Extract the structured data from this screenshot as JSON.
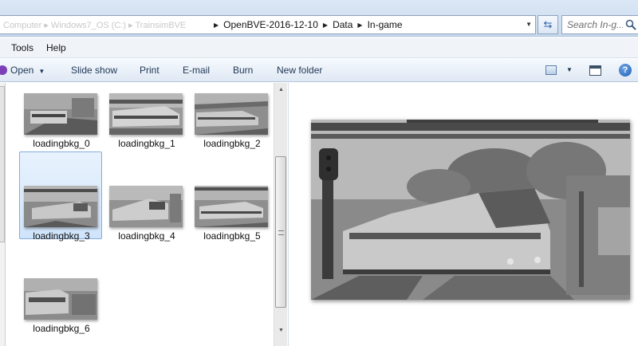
{
  "address_bar": {
    "faded_path": "Computer  ▸  Windows7_OS (C:)  ▸  TrainsimBVE",
    "crumbs": [
      "OpenBVE-2016-12-10",
      "Data",
      "In-game"
    ]
  },
  "search": {
    "placeholder": "Search In-g..."
  },
  "menu": {
    "items": [
      "Tools",
      "Help"
    ]
  },
  "toolbar": {
    "open_label": "Open",
    "slideshow_label": "Slide show",
    "print_label": "Print",
    "email_label": "E-mail",
    "burn_label": "Burn",
    "newfolder_label": "New folder"
  },
  "files": [
    {
      "name": "loadingbkg_0",
      "selected": false
    },
    {
      "name": "loadingbkg_1",
      "selected": false
    },
    {
      "name": "loadingbkg_2",
      "selected": false
    },
    {
      "name": "loadingbkg_3",
      "selected": true
    },
    {
      "name": "loadingbkg_4",
      "selected": false
    },
    {
      "name": "loadingbkg_5",
      "selected": false
    },
    {
      "name": "loadingbkg_6",
      "selected": false
    }
  ],
  "colors": {
    "selection": "#cfe4fb",
    "selection_border": "#84acdd",
    "chrome": "#dbe7f5"
  },
  "icons": [
    "refresh-icon",
    "search-icon",
    "open-icon",
    "view-icon",
    "preview-pane-icon",
    "help-icon"
  ]
}
